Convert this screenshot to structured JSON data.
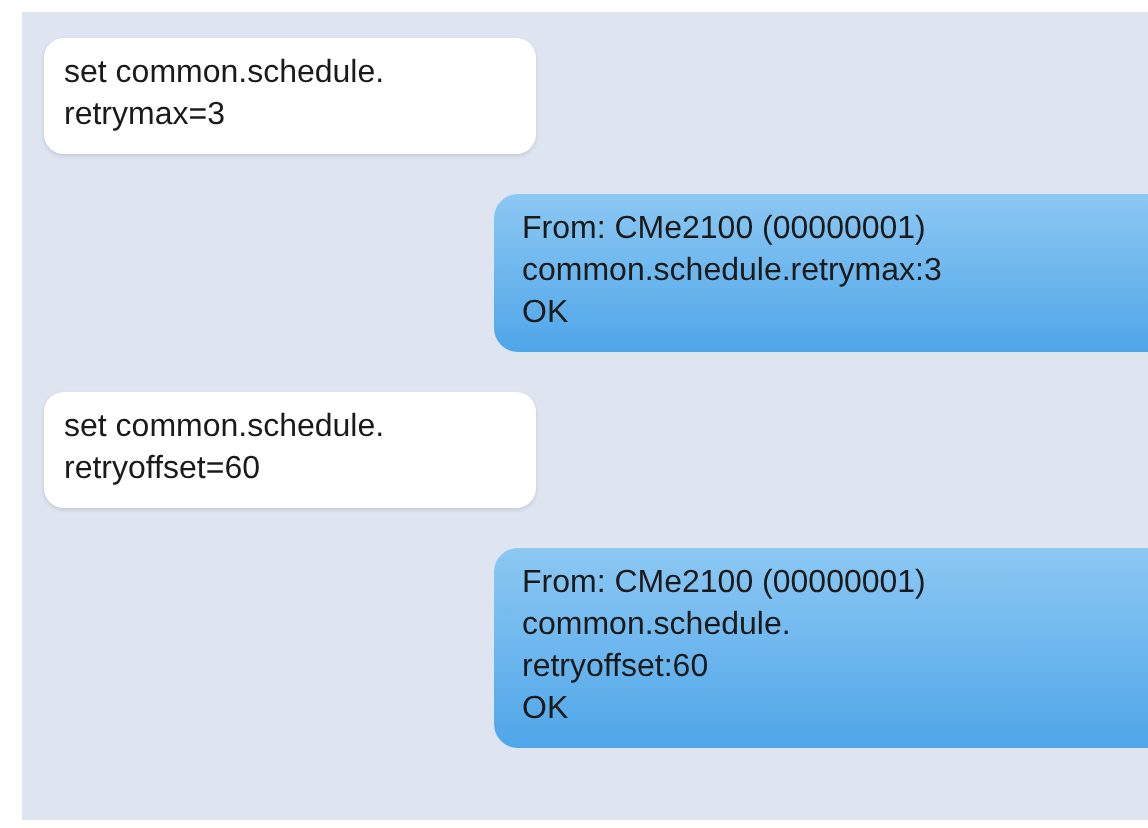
{
  "messages": [
    {
      "kind": "incoming",
      "text": "set common.schedule.\nretrymax=3"
    },
    {
      "kind": "outgoing",
      "text": "From: CMe2100 (00000001)\ncommon.schedule.retrymax:3\nOK"
    },
    {
      "kind": "incoming",
      "text": "set common.schedule.\nretryoffset=60"
    },
    {
      "kind": "outgoing",
      "text": "From: CMe2100 (00000001)\ncommon.schedule.\nretryoffset:60\nOK"
    }
  ]
}
